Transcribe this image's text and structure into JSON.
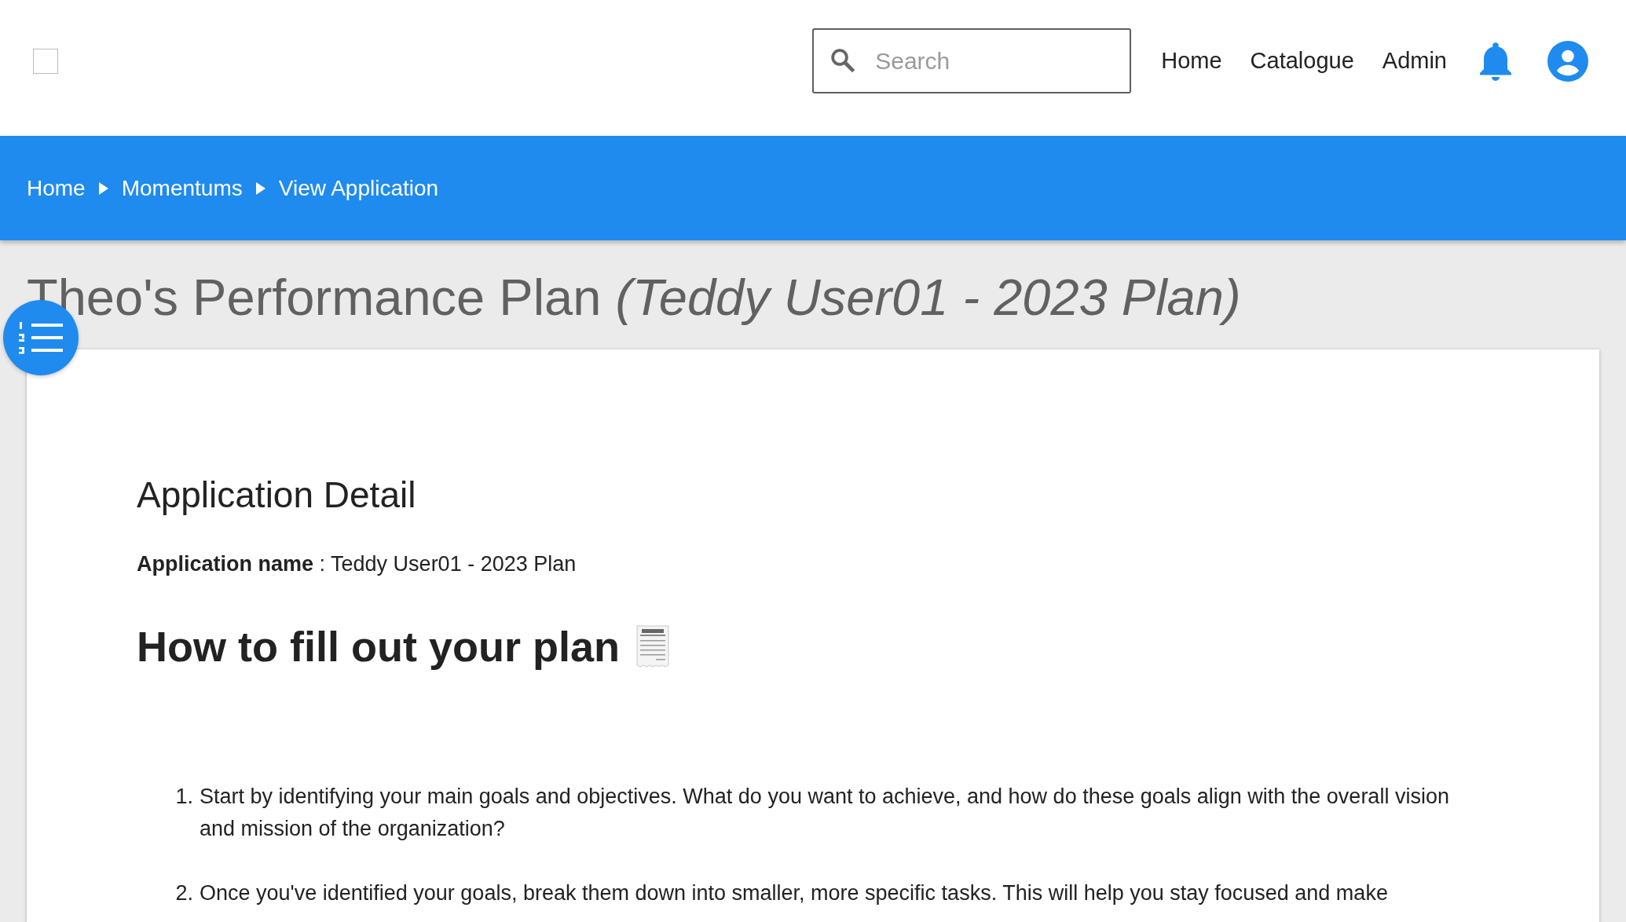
{
  "header": {
    "checkbox": {
      "checked": false
    },
    "search": {
      "placeholder": "Search"
    },
    "nav": [
      "Home",
      "Catalogue",
      "Admin"
    ]
  },
  "breadcrumb": [
    {
      "label": "Home"
    },
    {
      "label": "Momentums"
    },
    {
      "label": "View Application"
    }
  ],
  "title": "Theo's Performance Plan *(Teddy User01 - 2023 Plan)*",
  "card": {
    "heading": "Application Detail",
    "field_label": "Application name",
    "field_value": ": Teddy User01 - 2023 Plan",
    "section_title": "How to fill out your plan",
    "steps": [
      {
        "number": "1.",
        "text": "Start by identifying your main goals and objectives. What do you want to achieve, and how do these goals align with the overall vision and mission of the organization?"
      },
      {
        "number": "2.",
        "text": "Once you've identified your goals, break them down into smaller, more specific tasks. This will help you stay focused and make"
      }
    ]
  }
}
